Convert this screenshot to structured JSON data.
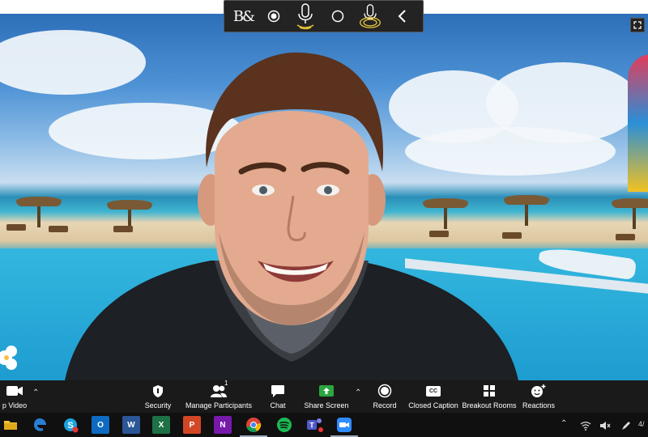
{
  "overlay": {
    "logo": "B&",
    "items": [
      "record-dot-icon",
      "mic-icon",
      "circle-icon",
      "mic-active-icon",
      "chevron-left-icon"
    ]
  },
  "toolbar": {
    "stop_video_label": "p Video",
    "security_label": "Security",
    "participants_label": "Manage Participants",
    "participants_count": "1",
    "chat_label": "Chat",
    "share_label": "Share Screen",
    "record_label": "Record",
    "cc_label": "Closed Caption",
    "cc_badge": "CC",
    "breakout_label": "Breakout Rooms",
    "reactions_label": "Reactions"
  },
  "taskbar": {
    "apps": [
      "folder",
      "edge",
      "skype",
      "outlook",
      "word",
      "excel",
      "powerpoint",
      "onenote",
      "chrome",
      "spotify",
      "teams",
      "zoom"
    ],
    "word_letter": "W",
    "excel_letter": "X",
    "powerpoint_letter": "P",
    "onenote_letter": "N",
    "outlook_letter": "O",
    "clock": "4/"
  },
  "colors": {
    "toolbar_bg": "#1a1a1a",
    "share_green": "#2ba640",
    "taskbar_bg": "#101010"
  }
}
